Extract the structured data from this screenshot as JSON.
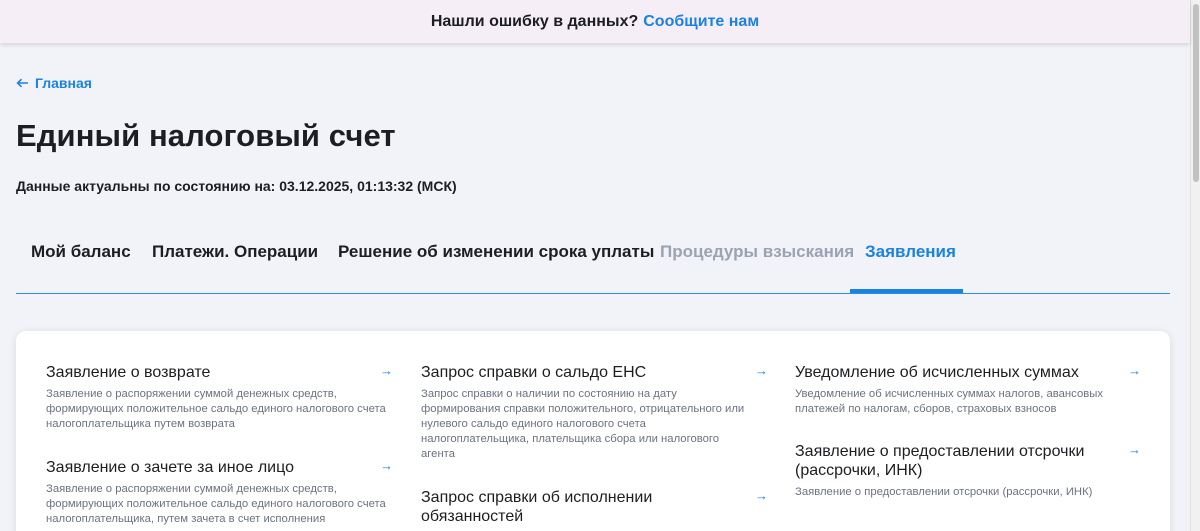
{
  "banner": {
    "text": "Нашли ошибку в данных?",
    "link": "Сообщите нам"
  },
  "back": {
    "label": "Главная"
  },
  "page": {
    "title": "Единый налоговый счет",
    "actual": "Данные актуальны по состоянию на: 03.12.2025, 01:13:32 (МСК)"
  },
  "tabs": [
    {
      "label": "Мой баланс"
    },
    {
      "label": "Платежи. Операции"
    },
    {
      "label": "Решение об изменении срока уплаты"
    },
    {
      "label": "Процедуры взыскания"
    },
    {
      "label": "Заявления"
    }
  ],
  "items": [
    {
      "title": "Заявление о возврате",
      "desc": "Заявление о распоряжении суммой денежных средств, формирующих положительное сальдо единого налогового счета налогоплательщика путем возврата"
    },
    {
      "title": "Заявление о зачете за иное лицо",
      "desc": "Заявление о распоряжении суммой денежных средств, формирующих положительное сальдо единого налогового счета налогоплательщика, путем зачета в счет исполнения"
    },
    {
      "title": "Запрос справки о сальдо ЕНС",
      "desc": "Запрос справки о наличии по состоянию на дату формирования справки положительного, отрицательного или нулевого сальдо единого налогового счета налогоплательщика, плательщика сбора или налогового агента"
    },
    {
      "title": "Запрос справки об исполнении обязанностей",
      "desc": ""
    },
    {
      "title": "Уведомление об исчисленных суммах",
      "desc": "Уведомление об исчисленных суммах налогов, авансовых платежей по налогам, сборов, страховых взносов"
    },
    {
      "title": "Заявление о предоставлении отсрочки (рассрочки, ИНК)",
      "desc": "Заявление о предоставлении отсрочки (рассрочки, ИНК)"
    }
  ],
  "icons": {
    "arrow": "arrow-right-icon",
    "back": "arrow-left-icon"
  },
  "colors": {
    "accent": "#1a82e2",
    "banner_bg": "#f6eef6",
    "page_bg": "#f1f3f8",
    "muted_tab": "#9aa3b2"
  }
}
